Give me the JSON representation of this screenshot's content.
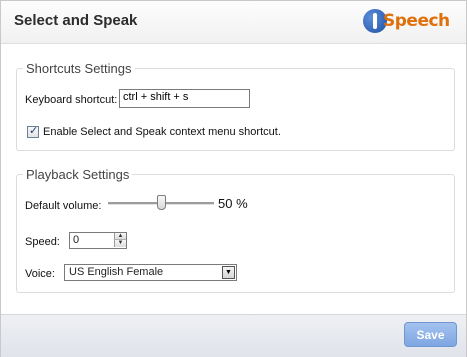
{
  "header": {
    "title": "Select and Speak",
    "logo_text": "Speech"
  },
  "shortcuts": {
    "legend": "Shortcuts Settings",
    "keyboard_label": "Keyboard shortcut:",
    "keyboard_value": "ctrl + shift + s",
    "context_menu_label": "Enable Select and Speak context menu shortcut.",
    "context_menu_checked": true
  },
  "playback": {
    "legend": "Playback Settings",
    "volume_label": "Default volume:",
    "volume_value_text": "50 %",
    "volume_percent": 50,
    "speed_label": "Speed:",
    "speed_value": "0",
    "voice_label": "Voice:",
    "voice_value": "US English Female"
  },
  "footer": {
    "save_label": "Save"
  },
  "colors": {
    "logo_orange": "#e0700a",
    "logo_blue": "#1e4fa3",
    "save_button": "#8fb2e8"
  }
}
